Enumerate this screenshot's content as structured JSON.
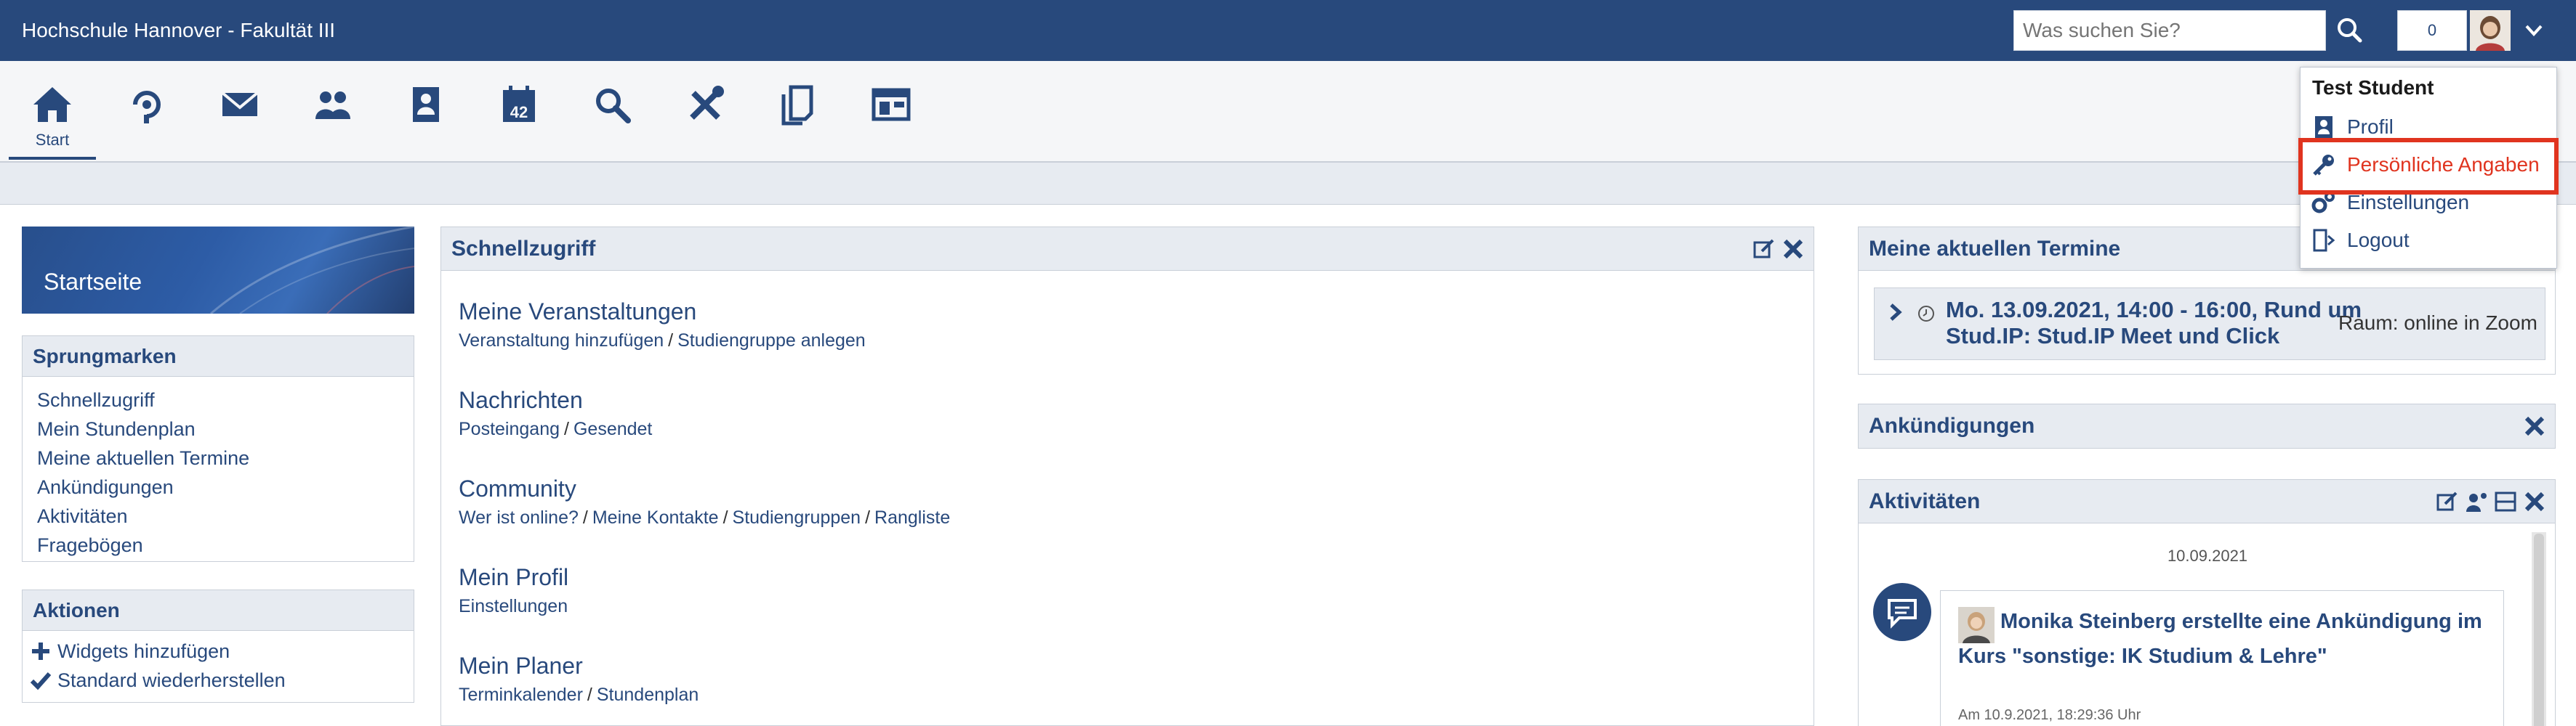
{
  "header": {
    "brand": "Hochschule Hannover - Fakultät III",
    "search_placeholder": "Was suchen Sie?",
    "notification_count": "0"
  },
  "nav": {
    "items": [
      {
        "name": "start",
        "label": "Start",
        "icon": "home-icon"
      },
      {
        "name": "activity",
        "label": "",
        "icon": "activity-icon"
      },
      {
        "name": "messages",
        "label": "",
        "icon": "mail-icon"
      },
      {
        "name": "community",
        "label": "",
        "icon": "people-icon"
      },
      {
        "name": "profile",
        "label": "",
        "icon": "profile-icon"
      },
      {
        "name": "planner",
        "label": "",
        "icon": "calendar-icon"
      },
      {
        "name": "search",
        "label": "",
        "icon": "search-icon"
      },
      {
        "name": "tools",
        "label": "",
        "icon": "tools-icon"
      },
      {
        "name": "courses",
        "label": "",
        "icon": "documents-icon"
      },
      {
        "name": "admin",
        "label": "",
        "icon": "layout-icon"
      }
    ]
  },
  "sidebar": {
    "hero_title": "Startseite",
    "jump_title": "Sprungmarken",
    "jump_links": [
      "Schnellzugriff",
      "Mein Stundenplan",
      "Meine aktuellen Termine",
      "Ankündigungen",
      "Aktivitäten",
      "Fragebögen"
    ],
    "actions_title": "Aktionen",
    "actions": [
      {
        "label": "Widgets hinzufügen",
        "icon": "plus-icon"
      },
      {
        "label": "Standard wiederherstellen",
        "icon": "checkmark-icon"
      }
    ]
  },
  "quickaccess": {
    "title": "Schnellzugriff",
    "sections": [
      {
        "title": "Meine Veranstaltungen",
        "links": [
          "Veranstaltung hinzufügen",
          "Studiengruppe anlegen"
        ]
      },
      {
        "title": "Nachrichten",
        "links": [
          "Posteingang",
          "Gesendet"
        ]
      },
      {
        "title": "Community",
        "links": [
          "Wer ist online?",
          "Meine Kontakte",
          "Studiengruppen",
          "Rangliste"
        ]
      },
      {
        "title": "Mein Profil",
        "links": [
          "Einstellungen"
        ]
      },
      {
        "title": "Mein Planer",
        "links": [
          "Terminkalender",
          "Stundenplan"
        ]
      }
    ]
  },
  "appointments": {
    "title": "Meine aktuellen Termine",
    "entry_title": "Mo. 13.09.2021, 14:00 - 16:00, Rund um Stud.IP: Stud.IP Meet und Click",
    "entry_room": "Raum: online in Zoom"
  },
  "announcements": {
    "title": "Ankündigungen"
  },
  "activities": {
    "title": "Aktivitäten",
    "date": "10.09.2021",
    "text": "Monika Steinberg erstellte eine Ankündigung im Kurs \"sonstige: IK Studium & Lehre\"",
    "time": "Am 10.9.2021, 18:29:36 Uhr"
  },
  "user_menu": {
    "user_name": "Test Student",
    "items": [
      {
        "label": "Profil",
        "icon": "profile-icon"
      },
      {
        "label": "Persönliche Angaben",
        "icon": "key-icon",
        "highlight": true
      },
      {
        "label": "Einstellungen",
        "icon": "gears-icon"
      },
      {
        "label": "Logout",
        "icon": "logout-icon"
      }
    ]
  },
  "colors": {
    "brand": "#28497c",
    "highlight": "#e0341f",
    "panel_header": "#e7ebf1"
  }
}
